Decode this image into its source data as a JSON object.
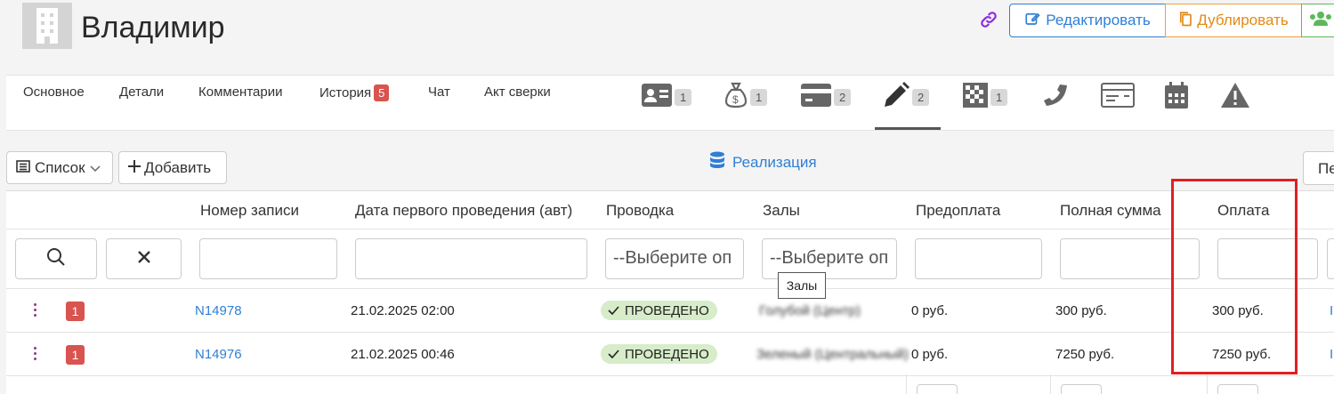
{
  "header": {
    "title": "Владимир",
    "edit_label": "Редактировать",
    "duplicate_label": "Дублировать",
    "icons": [
      "building-icon",
      "link-icon",
      "edit-icon",
      "copy-icon",
      "users-icon"
    ]
  },
  "tabs": {
    "items": [
      {
        "label": "Основное"
      },
      {
        "label": "Детали"
      },
      {
        "label": "Комментарии"
      },
      {
        "label": "История",
        "badge": "5"
      },
      {
        "label": "Чат"
      },
      {
        "label": "Акт сверки"
      }
    ],
    "icon_tabs": [
      {
        "icon": "id-card-icon",
        "count": "1"
      },
      {
        "icon": "money-bag-icon",
        "count": "1"
      },
      {
        "icon": "credit-card-icon",
        "count": "2"
      },
      {
        "icon": "pen-icon",
        "count": "2",
        "active": true
      },
      {
        "icon": "checkered-icon",
        "count": "1"
      },
      {
        "icon": "phone-icon"
      },
      {
        "icon": "invoice-card-icon"
      },
      {
        "icon": "calendar-icon"
      },
      {
        "icon": "warning-icon"
      }
    ]
  },
  "toolbar": {
    "list_label": "Список",
    "add_label": "Добавить",
    "realization_label": "Реализация",
    "right_button_label": "Пе"
  },
  "table": {
    "columns": {
      "record_number": "Номер записи",
      "first_date": "Дата первого проведения (авт)",
      "posting": "Проводка",
      "halls": "Залы",
      "prepayment": "Предоплата",
      "full_sum": "Полная сумма",
      "payment": "Оплата"
    },
    "filters": {
      "posting_placeholder": "--Выберите оп",
      "halls_placeholder": "--Выберите оп"
    },
    "tooltip": "Залы",
    "rows": [
      {
        "badge": "1",
        "number": "N14978",
        "date": "21.02.2025 02:00",
        "status": "ПРОВЕДЕНО",
        "halls": "Голубой (Центр)",
        "prepayment": "0 руб.",
        "full_sum": "300 руб.",
        "payment": "300 руб."
      },
      {
        "badge": "1",
        "number": "N14976",
        "date": "21.02.2025 00:46",
        "status": "ПРОВЕДЕНО",
        "halls": "Зеленый (Центральный)",
        "prepayment": "0 руб.",
        "full_sum": "7250 руб.",
        "payment": "7250 руб."
      }
    ]
  },
  "colors": {
    "accent_blue": "#2f7fd5",
    "duplicate_orange": "#e38a17",
    "users_green": "#5cb85c",
    "status_green_bg": "#d7ecc9",
    "badge_red": "#d9534f",
    "highlight_red": "#e02020"
  }
}
